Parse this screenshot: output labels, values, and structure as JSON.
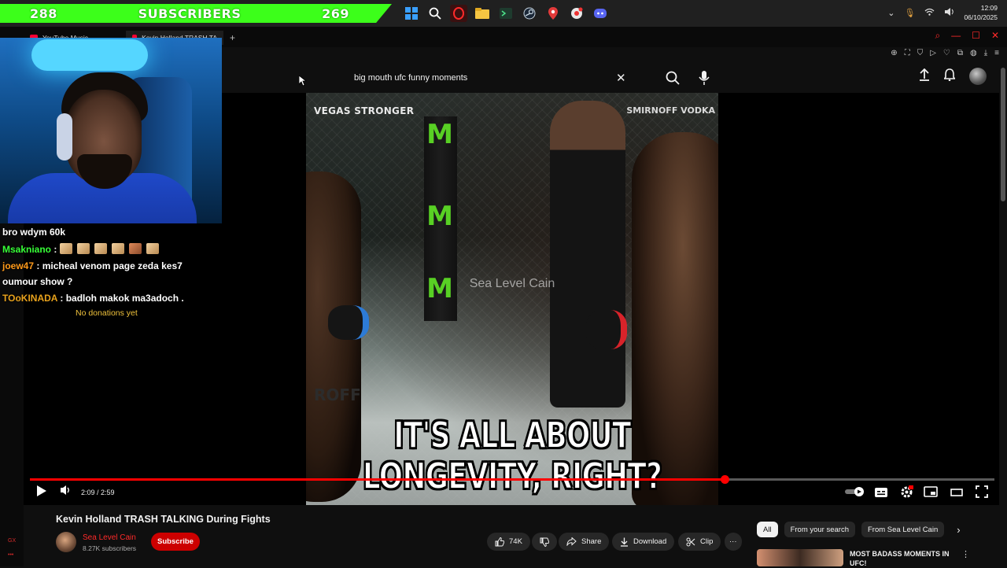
{
  "taskbar": {
    "banner_left_count": "288",
    "banner_label": "SUBSCRIBERS",
    "banner_right_count": "269",
    "clock_time": "12:09",
    "clock_date": "06/10/2025",
    "icons": [
      "windows-start-icon",
      "search-icon",
      "opera-icon",
      "file-explorer-icon",
      "terminal-icon",
      "steam-icon",
      "maps-pin-icon",
      "chrome-icon",
      "discord-icon"
    ]
  },
  "browser": {
    "tabs": [
      {
        "label": "YouTube Music"
      },
      {
        "label": "Kevin Holland TRASH TA"
      }
    ],
    "new_tab": "+"
  },
  "search": {
    "query": "big mouth ufc funny moments"
  },
  "video": {
    "overlay_top_left": "VEGAS STRONGER",
    "overlay_top_right": "SMIRNOFF VODKA",
    "watermark": "Sea Level Cain",
    "caption_line1": "IT'S ALL ABOUT",
    "caption_line2": "LONGEVITY, RIGHT?",
    "floor_text": "ROFF",
    "time_display": "2:09 / 2:59",
    "progress": 0.72
  },
  "chat": {
    "lines": [
      {
        "user": "",
        "text": "bro wdym 60k",
        "color": "#ffffff"
      },
      {
        "user": "Msakniano",
        "text": "",
        "color": "#37ff37"
      },
      {
        "user": "joew47",
        "text": "micheal venom page zeda kes7 oumour show ?",
        "color": "#ff9a1a"
      },
      {
        "user": "TOoKINADA",
        "text": "badloh makok ma3adoch .",
        "color": "#e8a21c"
      }
    ],
    "no_donations": "No donations yet"
  },
  "below": {
    "title": "Kevin Holland TRASH TALKING During Fights",
    "channel": "Sea Level Cain",
    "subs": "8.27K subscribers",
    "subscribe": "Subscribe",
    "likes": "74K",
    "share": "Share",
    "download": "Download",
    "clip": "Clip",
    "more": "···",
    "chips": [
      "All",
      "From your search",
      "From Sea Level Cain"
    ],
    "rec_title": "MOST BADASS MOMENTS IN UFC!"
  }
}
